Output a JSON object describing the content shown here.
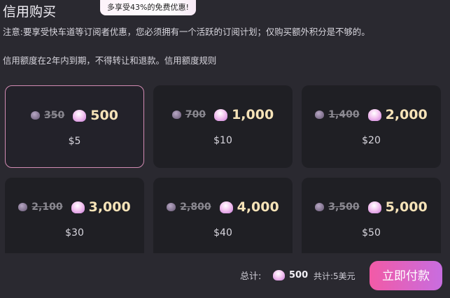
{
  "header": {
    "title": "信用购买",
    "promo": "多享受43%的免费优惠!"
  },
  "notice": "注意:要享受快车道等订阅者优惠，您必须拥有一个活跃的订阅计划；仅购买额外积分是不够的。",
  "expiry": "信用额度在2年内到期，不得转让和退款。信用额度规则",
  "packages": [
    {
      "old": "350",
      "new": "500",
      "usd": "$5",
      "selected": true
    },
    {
      "old": "700",
      "new": "1,000",
      "usd": "$10"
    },
    {
      "old": "1,400",
      "new": "2,000",
      "usd": "$20"
    },
    {
      "old": "2,100",
      "new": "3,000",
      "usd": "$30"
    },
    {
      "old": "2,800",
      "new": "4,000",
      "usd": "$40"
    },
    {
      "old": "3,500",
      "new": "5,000",
      "usd": "$50"
    }
  ],
  "footer": {
    "total_label": "总计:",
    "total_amount": "500",
    "total_usd": "共计:5美元",
    "pay_label": "立即付款"
  },
  "icons": {
    "credit": "shell-icon"
  },
  "colors": {
    "accent_start": "#f25aa6",
    "accent_end": "#c86de0",
    "selected_border": "#d28bb3",
    "price_text": "#f6e3b8"
  }
}
